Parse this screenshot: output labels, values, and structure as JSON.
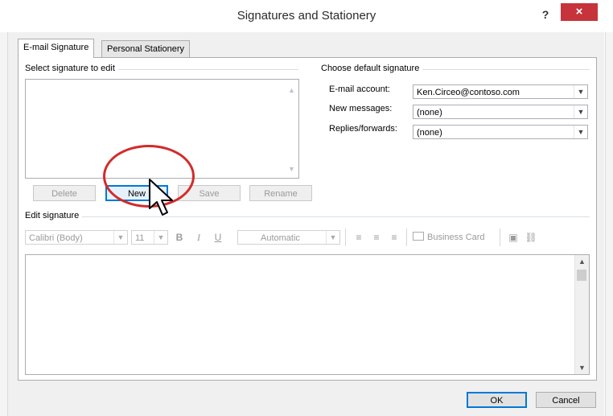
{
  "window": {
    "title": "Signatures and Stationery",
    "help_label": "?",
    "close_label": "×"
  },
  "tabs": [
    {
      "label": "E-mail Signature",
      "active": true
    },
    {
      "label": "Personal Stationery",
      "active": false
    }
  ],
  "select_section": {
    "label": "Select signature to edit",
    "items": [],
    "buttons": {
      "delete": "Delete",
      "new": "New",
      "save": "Save",
      "rename": "Rename"
    }
  },
  "default_section": {
    "label": "Choose default signature",
    "email_account": {
      "label": "E-mail account:",
      "value": "Ken.Circeo@contoso.com"
    },
    "new_messages": {
      "label": "New messages:",
      "value": "(none)"
    },
    "replies_forwards": {
      "label": "Replies/forwards:",
      "value": "(none)"
    }
  },
  "edit_section": {
    "label": "Edit signature",
    "font_name": "Calibri (Body)",
    "font_size": "11",
    "bold": "B",
    "italic": "I",
    "underline": "U",
    "color": "Automatic",
    "business_card": "Business Card"
  },
  "footer": {
    "ok": "OK",
    "cancel": "Cancel"
  },
  "colors": {
    "close_button": "#c7333b",
    "annotation_circle": "#d42a2a",
    "focus_border": "#0078d7"
  }
}
